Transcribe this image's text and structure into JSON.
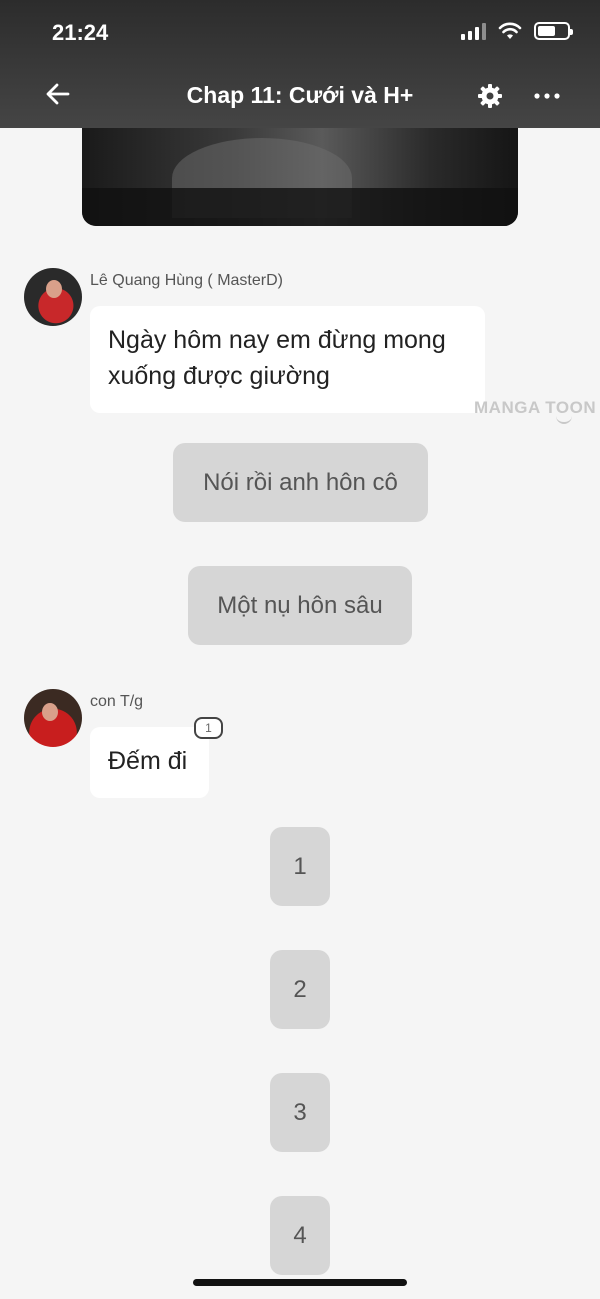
{
  "status_bar": {
    "time": "21:24"
  },
  "nav": {
    "title": "Chap 11: Cưới và H+"
  },
  "messages": [
    {
      "sender": "Lê Quang Hùng ( MasterD)",
      "text_line1": "Ngày hôm nay em đừng mong",
      "text_line2": "xuống được giường"
    },
    {
      "sender": "con T/g",
      "text": "Đếm đi",
      "badge": "1"
    }
  ],
  "choices": [
    "Nói rồi anh hôn cô",
    "Một nụ hôn sâu"
  ],
  "counts": [
    "1",
    "2",
    "3",
    "4"
  ],
  "watermark": "MANGA TOON",
  "colors": {
    "header_bg": "#3a3a3a",
    "page_bg": "#f5f5f5",
    "choice_bg": "#d6d6d6",
    "bubble_bg": "#ffffff"
  }
}
